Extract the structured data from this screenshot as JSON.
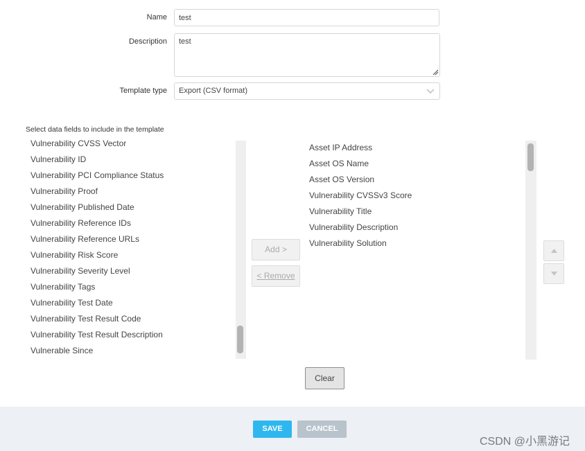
{
  "form": {
    "name_label": "Name",
    "name_value": "test",
    "description_label": "Description",
    "description_value": "test",
    "template_type_label": "Template type",
    "template_type_value": "Export (CSV format)"
  },
  "fields_section": {
    "label": "Select data fields to include in the template"
  },
  "available_fields": [
    "Vulnerability CVSS Vector",
    "Vulnerability ID",
    "Vulnerability PCI Compliance Status",
    "Vulnerability Proof",
    "Vulnerability Published Date",
    "Vulnerability Reference IDs",
    "Vulnerability Reference URLs",
    "Vulnerability Risk Score",
    "Vulnerability Severity Level",
    "Vulnerability Tags",
    "Vulnerability Test Date",
    "Vulnerability Test Result Code",
    "Vulnerability Test Result Description",
    "Vulnerable Since"
  ],
  "selected_fields": [
    "Asset IP Address",
    "Asset OS Name",
    "Asset OS Version",
    "Vulnerability CVSSv3 Score",
    "Vulnerability Title",
    "Vulnerability Description",
    "Vulnerability Solution"
  ],
  "buttons": {
    "add": "Add >",
    "remove": "< Remove",
    "clear": "Clear",
    "save": "SAVE",
    "cancel": "CANCEL"
  },
  "watermark": "CSDN @小黑游记",
  "colors": {
    "save": "#2eb7ef",
    "cancel": "#b8c3cc",
    "footer": "#edf0f4"
  },
  "icons": {
    "move_up": "triangle-up-icon",
    "move_down": "triangle-down-icon",
    "dropdown": "chevron-down-icon",
    "resize": "resize-grip-icon"
  }
}
